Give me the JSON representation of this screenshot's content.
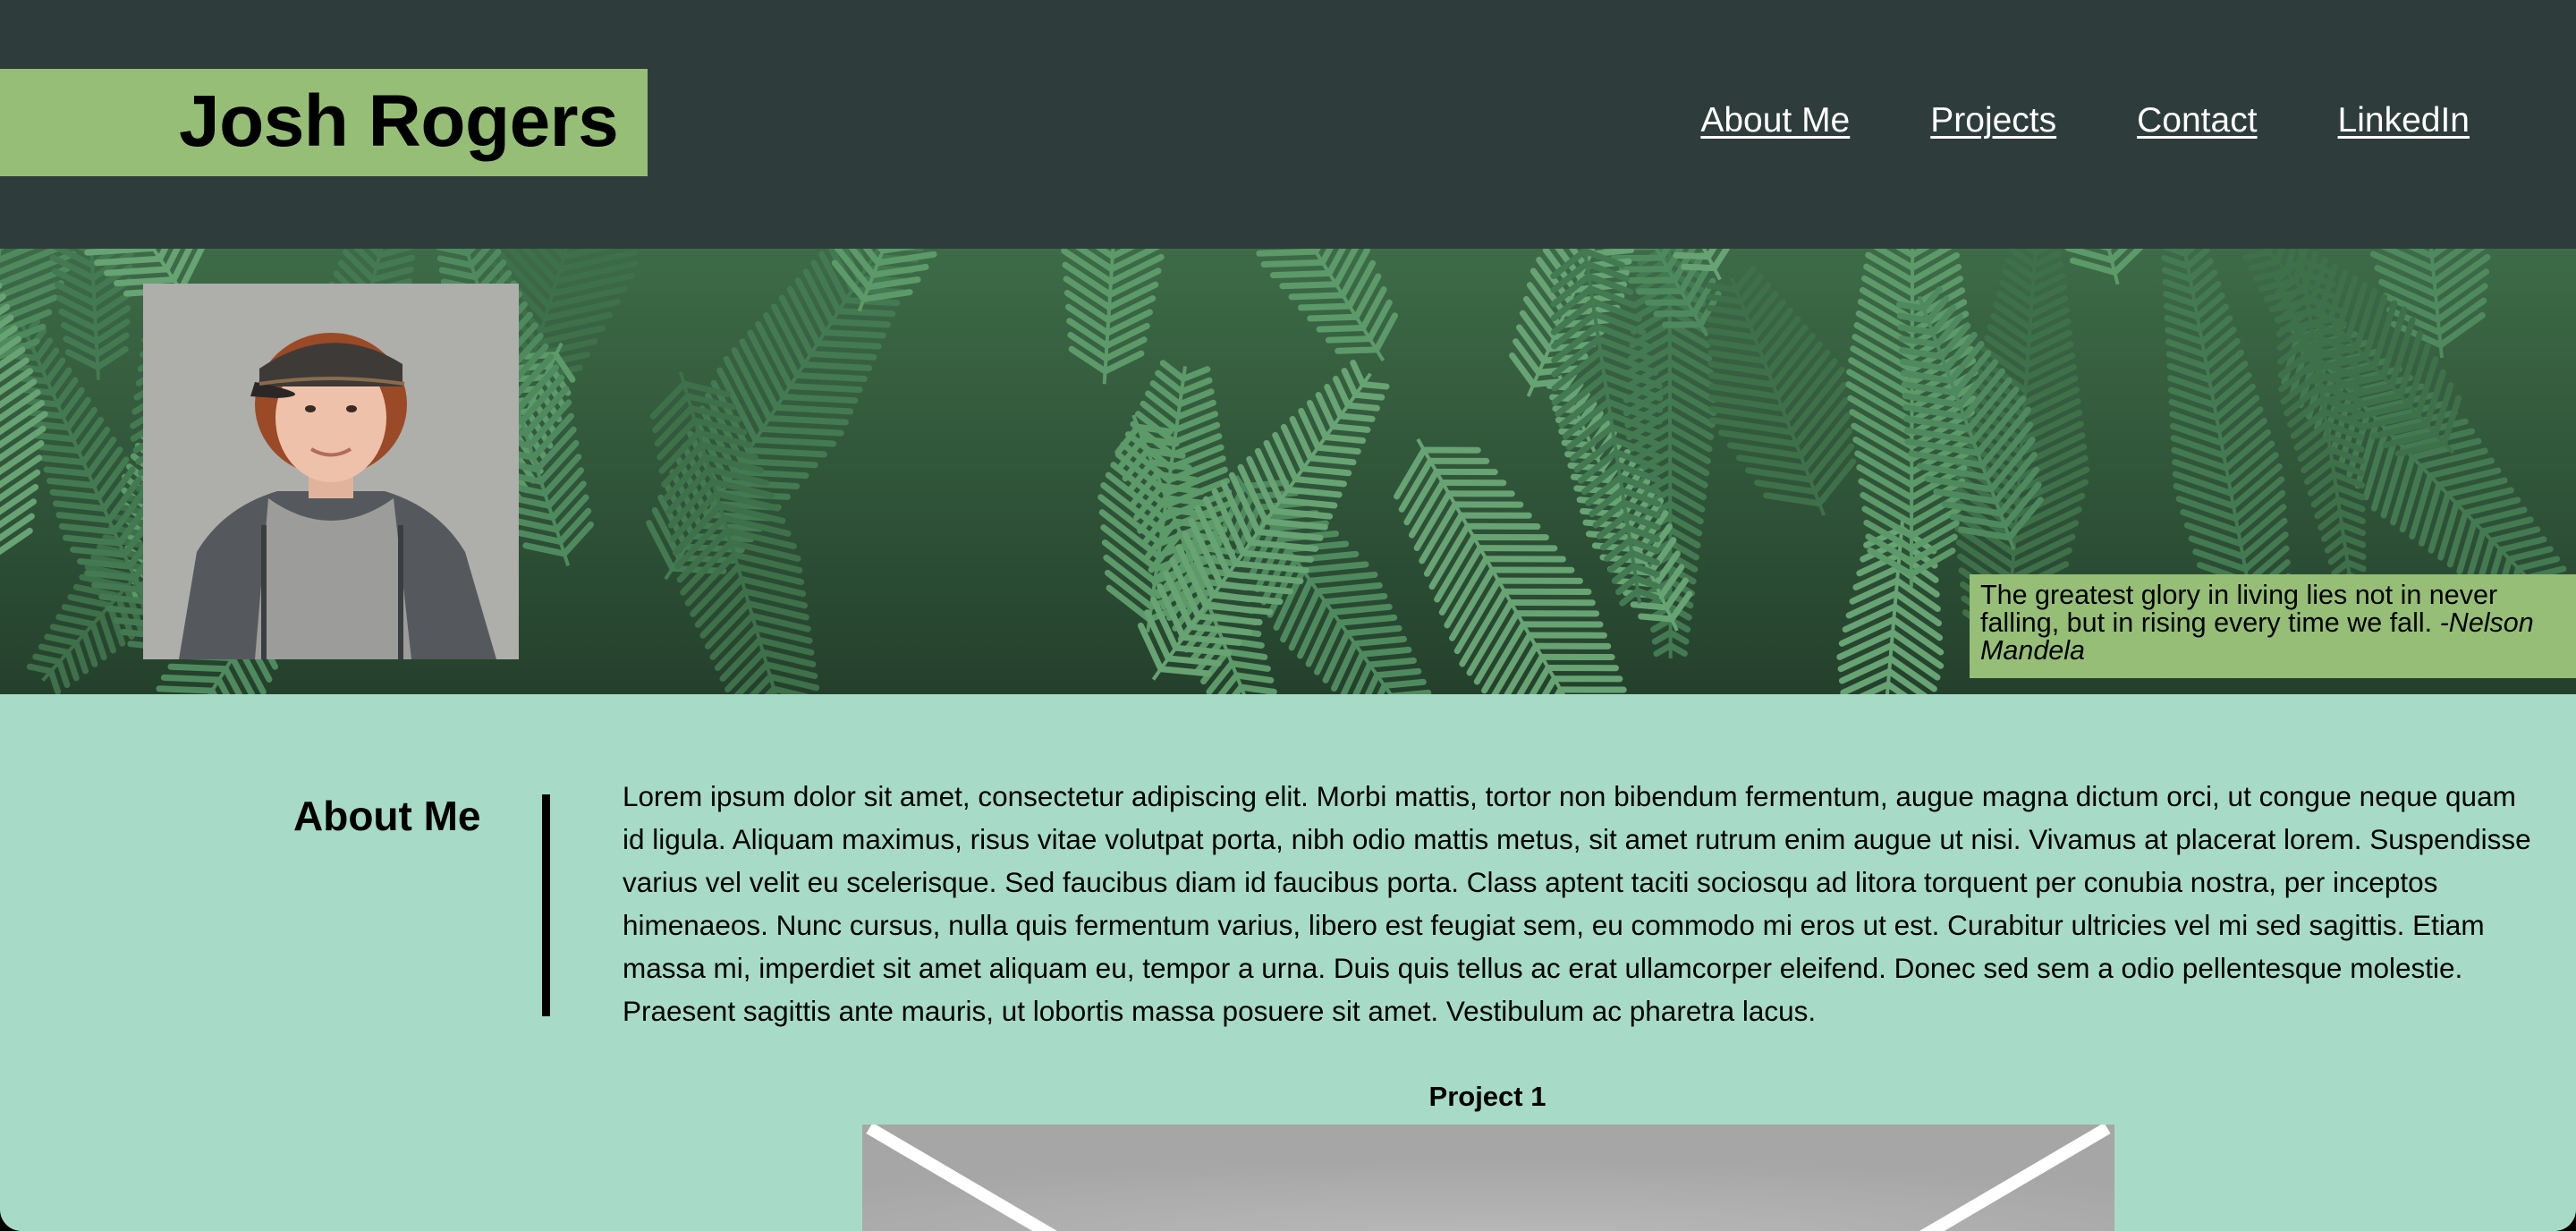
{
  "header": {
    "name": "Josh Rogers",
    "nav": [
      "About Me",
      "Projects",
      "Contact",
      "LinkedIn"
    ]
  },
  "hero": {
    "quote_text": "The greatest glory in living lies not in never falling, but in rising every time we fall.",
    "quote_author": "-Nelson Mandela"
  },
  "about": {
    "heading": "About Me",
    "body": "Lorem ipsum dolor sit amet, consectetur adipiscing elit. Morbi mattis, tortor non bibendum fermentum, augue magna dictum orci, ut congue neque quam id ligula. Aliquam maximus, risus vitae volutpat porta, nibh odio mattis metus, sit amet rutrum enim augue ut nisi. Vivamus at placerat lorem. Suspendisse varius vel velit eu scelerisque. Sed faucibus diam id faucibus porta. Class aptent taciti sociosqu ad litora torquent per conubia nostra, per inceptos himenaeos. Nunc cursus, nulla quis fermentum varius, libero est feugiat sem, eu commodo mi eros ut est. Curabitur ultricies vel mi sed sagittis. Etiam massa mi, imperdiet sit amet aliquam eu, tempor a urna. Duis quis tellus ac erat ullamcorper eleifend. Donec sed sem a odio pellentesque molestie. Praesent sagittis ante mauris, ut lobortis massa posuere sit amet. Vestibulum ac pharetra lacus."
  },
  "projects": [
    {
      "title": "Project 1"
    }
  ],
  "colors": {
    "header_bg": "#2e3d3b",
    "accent_green": "#97be77",
    "page_bg": "#a7dbc8",
    "fern_green": "#4f8a5e"
  }
}
